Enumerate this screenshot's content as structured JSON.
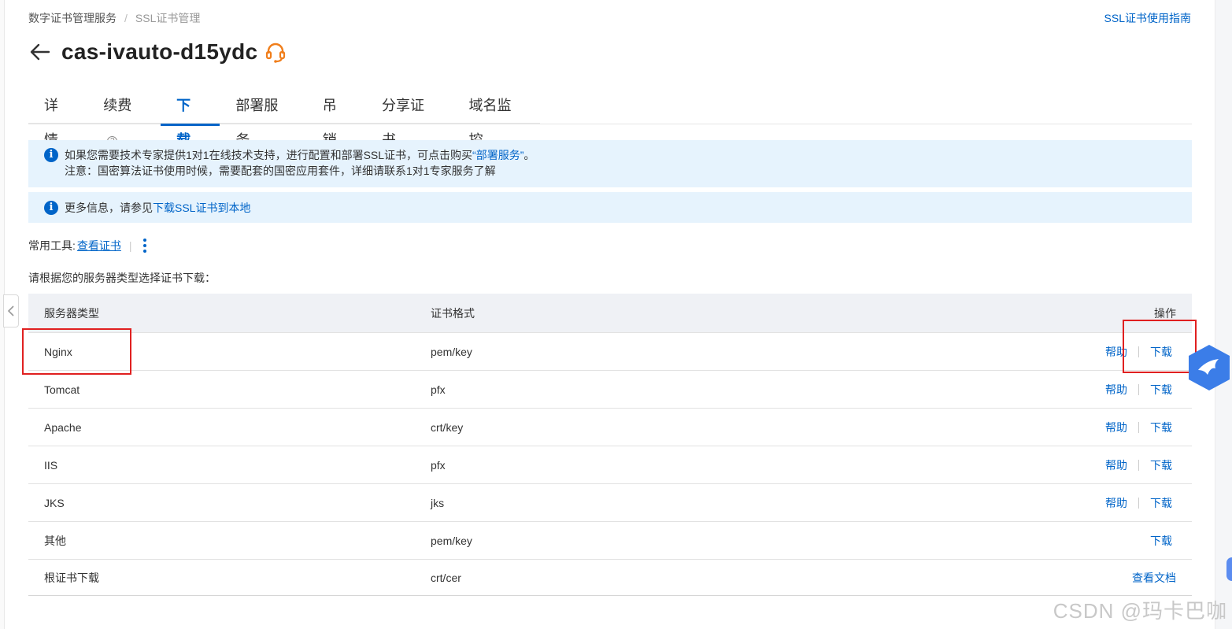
{
  "breadcrumb": {
    "parent": "数字证书管理服务",
    "current": "SSL证书管理"
  },
  "guide_link": "SSL证书使用指南",
  "page_title": "cas-ivauto-d15ydc",
  "tabs": [
    {
      "label": "详情"
    },
    {
      "label": "续费",
      "help": "?"
    },
    {
      "label": "下载",
      "active": true
    },
    {
      "label": "部署服务"
    },
    {
      "label": "吊销"
    },
    {
      "label": "分享证书"
    },
    {
      "label": "域名监控"
    }
  ],
  "notice1": {
    "text_before": "如果您需要技术专家提供1对1在线技术支持，进行配置和部署SSL证书，可点击购买",
    "link": "“部署服务”",
    "text_after": "。",
    "line2": "注意：国密算法证书使用时候，需要配套的国密应用套件，详细请联系1对1专家服务了解"
  },
  "notice2": {
    "text": "更多信息，请参见",
    "link": "下载SSL证书到本地"
  },
  "tools": {
    "label": "常用工具:",
    "view_cert": "查看证书"
  },
  "prompt": "请根据您的服务器类型选择证书下载：",
  "table": {
    "headers": {
      "server_type": "服务器类型",
      "cert_format": "证书格式",
      "actions": "操作"
    },
    "rows": [
      {
        "server": "Nginx",
        "format": "pem/key",
        "help": "帮助",
        "download": "下载"
      },
      {
        "server": "Tomcat",
        "format": "pfx",
        "help": "帮助",
        "download": "下载"
      },
      {
        "server": "Apache",
        "format": "crt/key",
        "help": "帮助",
        "download": "下载"
      },
      {
        "server": "IIS",
        "format": "pfx",
        "help": "帮助",
        "download": "下载"
      },
      {
        "server": "JKS",
        "format": "jks",
        "help": "帮助",
        "download": "下载"
      },
      {
        "server": "其他",
        "format": "pem/key",
        "download": "下载"
      },
      {
        "server": "根证书下载",
        "format": "crt/cer",
        "view_docs": "查看文档"
      }
    ]
  },
  "watermark": "CSDN @玛卡巴咖",
  "colors": {
    "accent": "#0064c8",
    "highlight_box": "#e02020",
    "notice_bg": "#e6f3fd",
    "support_icon": "#f07e1b"
  },
  "icons": {
    "back": "arrow-left-icon",
    "support": "headset-icon",
    "info": "info-icon",
    "more": "vertical-dots-icon",
    "collapse": "chevron-left-icon",
    "float": "bird-badge-icon"
  }
}
